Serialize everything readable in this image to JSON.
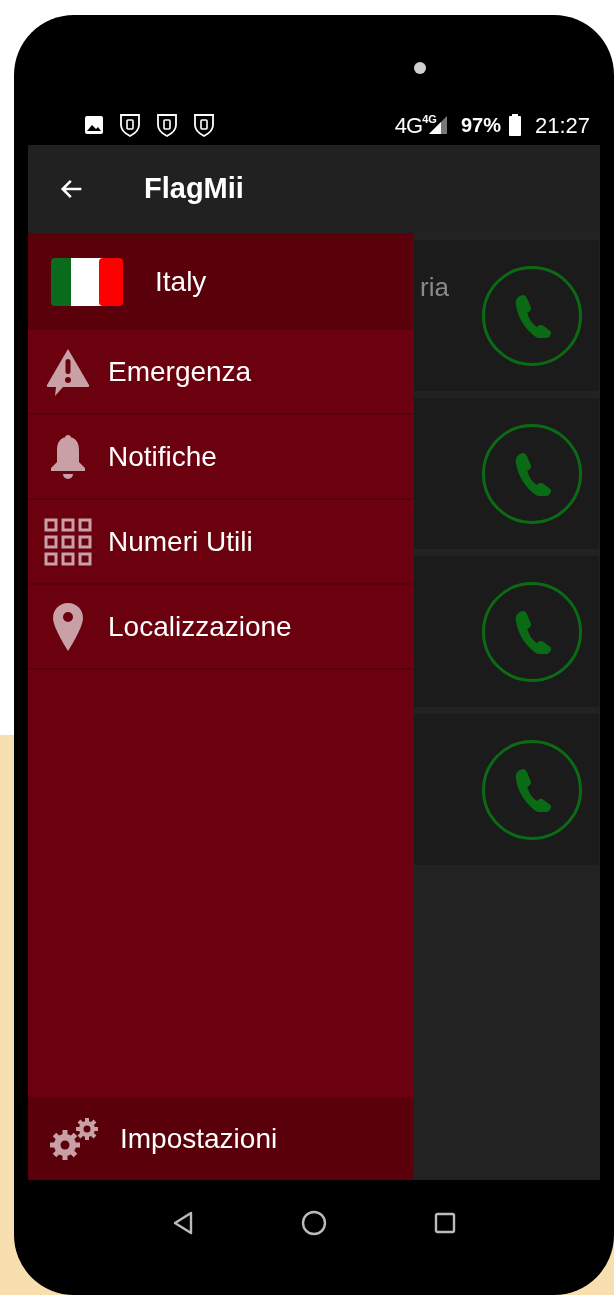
{
  "status_bar": {
    "network": "4G",
    "network_small": "4G",
    "battery": "97%",
    "time": "21:27"
  },
  "app_bar": {
    "title": "FlagMii"
  },
  "drawer": {
    "header": {
      "label": "Italy"
    },
    "items": [
      {
        "kind": "warning",
        "label": "Emergenza"
      },
      {
        "kind": "bell",
        "label": "Notifiche"
      },
      {
        "kind": "grid",
        "label": "Numeri Utili"
      },
      {
        "kind": "pin",
        "label": "Localizzazione"
      }
    ],
    "footer": {
      "kind": "gears",
      "label": "Impostazioni"
    }
  },
  "cards": [
    {
      "kind": "call",
      "title": "ria"
    },
    {
      "kind": "call"
    },
    {
      "kind": "call"
    },
    {
      "kind": "call"
    }
  ]
}
